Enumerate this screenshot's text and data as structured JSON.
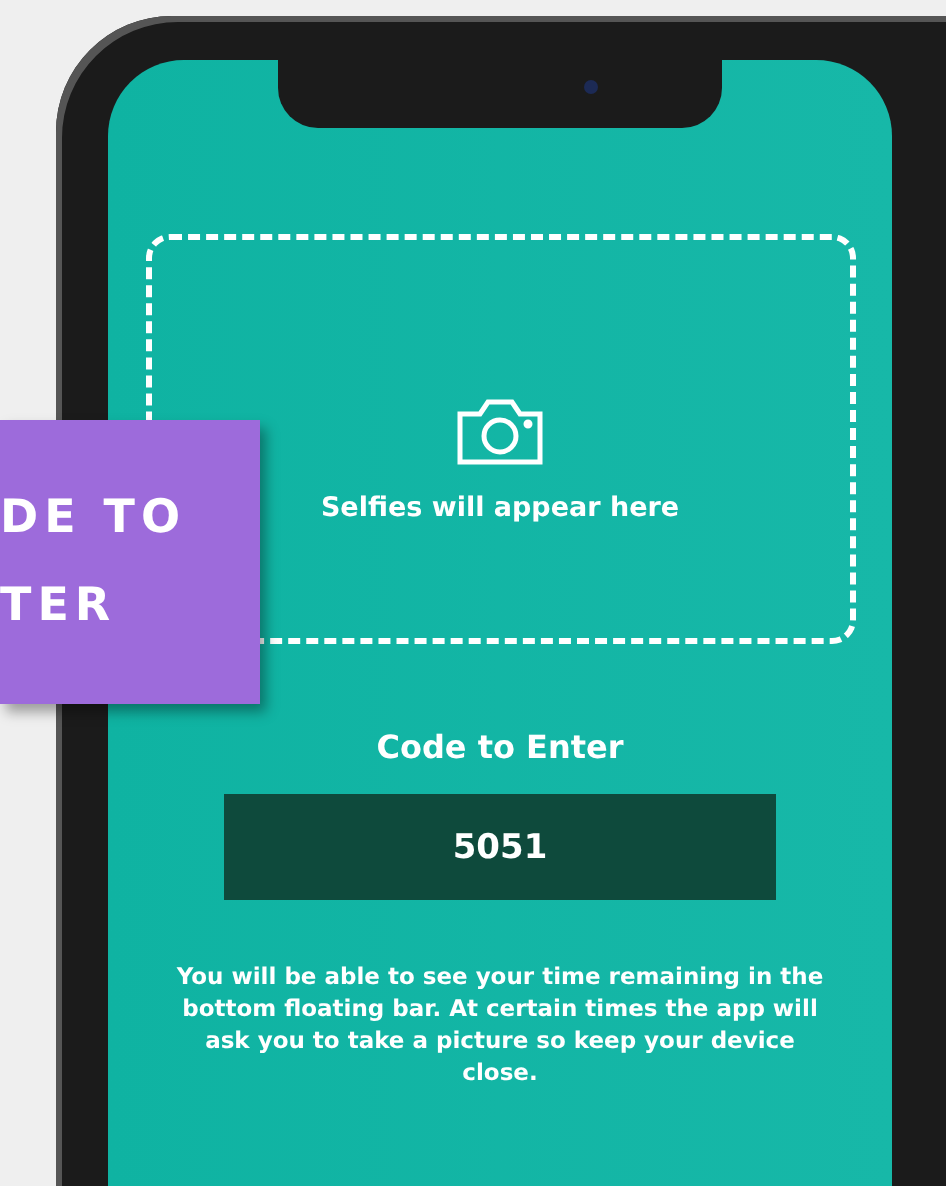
{
  "banner": {
    "lines": [
      "DE TO",
      "TER"
    ]
  },
  "selfie_area": {
    "caption": "Selfies will appear here"
  },
  "code": {
    "label": "Code to Enter",
    "value": "5051"
  },
  "info": "You will be able to see your time remaining in the bottom floating bar. At certain times the app will ask you to take a picture so keep your device close."
}
